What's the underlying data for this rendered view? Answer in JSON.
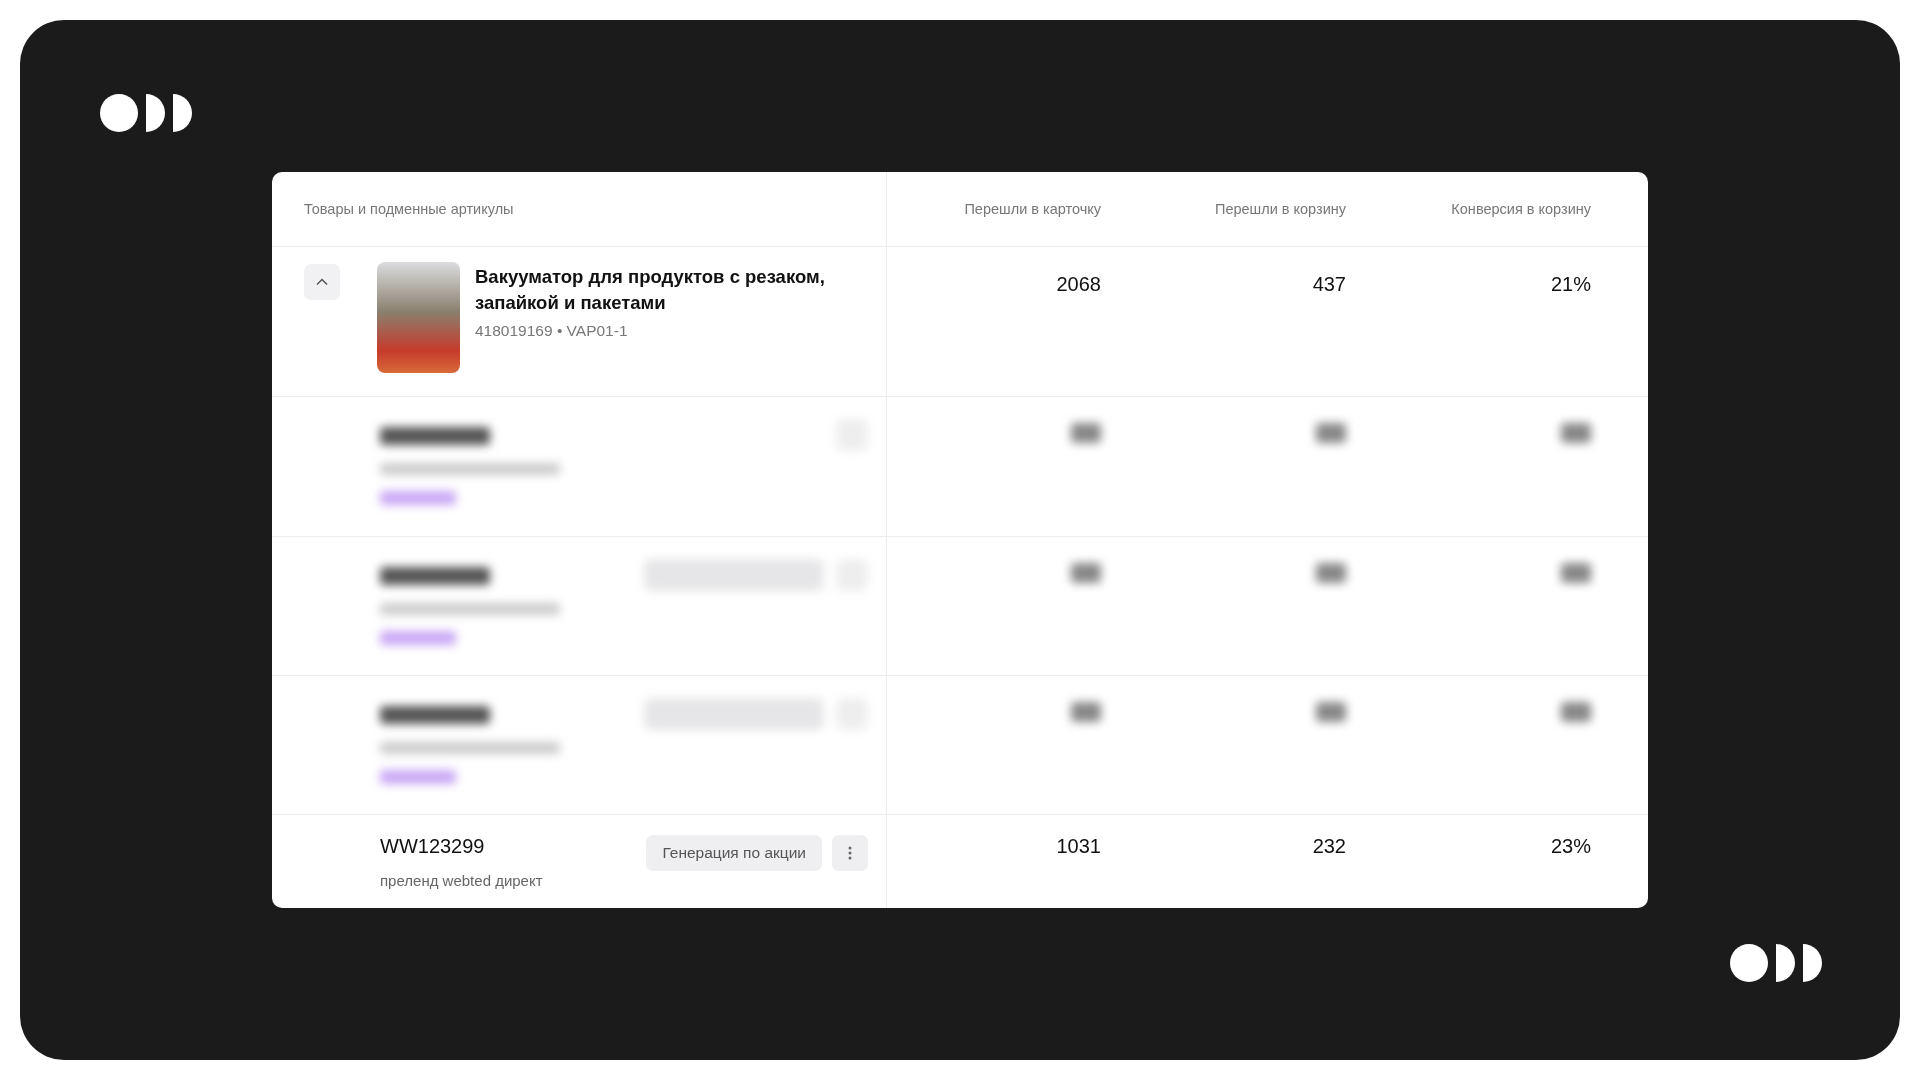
{
  "table": {
    "columns": [
      {
        "label": "Товары и подменные артикулы"
      },
      {
        "label": "Перешли в карточку"
      },
      {
        "label": "Перешли в корзину"
      },
      {
        "label": "Конверсия в корзину"
      }
    ],
    "rows": [
      {
        "kind": "product",
        "expanded": true,
        "title": "Вакууматор для продуктов с резаком, запайкой и пакетами",
        "meta": "418019169 • VAP01-1",
        "values": [
          "2068",
          "437",
          "21%"
        ]
      },
      {
        "kind": "blurred",
        "has_tag": false
      },
      {
        "kind": "blurred",
        "has_tag": true
      },
      {
        "kind": "blurred",
        "has_tag": true
      },
      {
        "kind": "variant",
        "code": "WW123299",
        "subtitle": "преленд webted директ",
        "tag": "Генерация по акции",
        "values": [
          "1031",
          "232",
          "23%"
        ]
      }
    ]
  }
}
